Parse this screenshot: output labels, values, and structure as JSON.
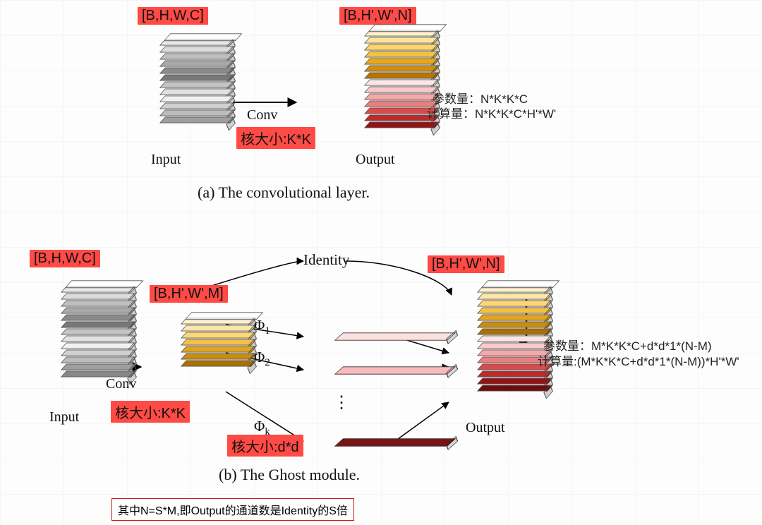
{
  "a": {
    "input_shape": "[B,H,W,C]",
    "output_shape": "[B,H',W',N]",
    "op_label": "Conv",
    "kernel_label": "核大小:K*K",
    "input_caption": "Input",
    "output_caption": "Output",
    "caption": "(a)  The convolutional layer.",
    "param_label": "参数量：N*K*K*C",
    "flop_label": "计算量：N*K*K*C*H'*W'"
  },
  "b": {
    "input_shape": "[B,H,W,C]",
    "mid_shape": "[B,H',W',M]",
    "output_shape": "[B,H',W',N]",
    "op_label": "Conv",
    "kernel_label": "核大小:K*K",
    "cheap_kernel_label": "核大小:d*d",
    "identity_label": "Identity",
    "phi1": "Φ",
    "phi1_sub": "1",
    "phi2": "Φ",
    "phi2_sub": "2",
    "phik": "Φ",
    "phik_sub": "k",
    "dots": "⋮",
    "input_caption": "Input",
    "output_caption": "Output",
    "caption": "(b)  The Ghost module.",
    "param_label": "参数量：M*K*K*C+d*d*1*(N-M)",
    "flop_label": "计算量:(M*K*K*C+d*d*1*(N-M))*H'*W'",
    "note": "其中N=S*M,即Output的通道数是Identity的S倍"
  }
}
